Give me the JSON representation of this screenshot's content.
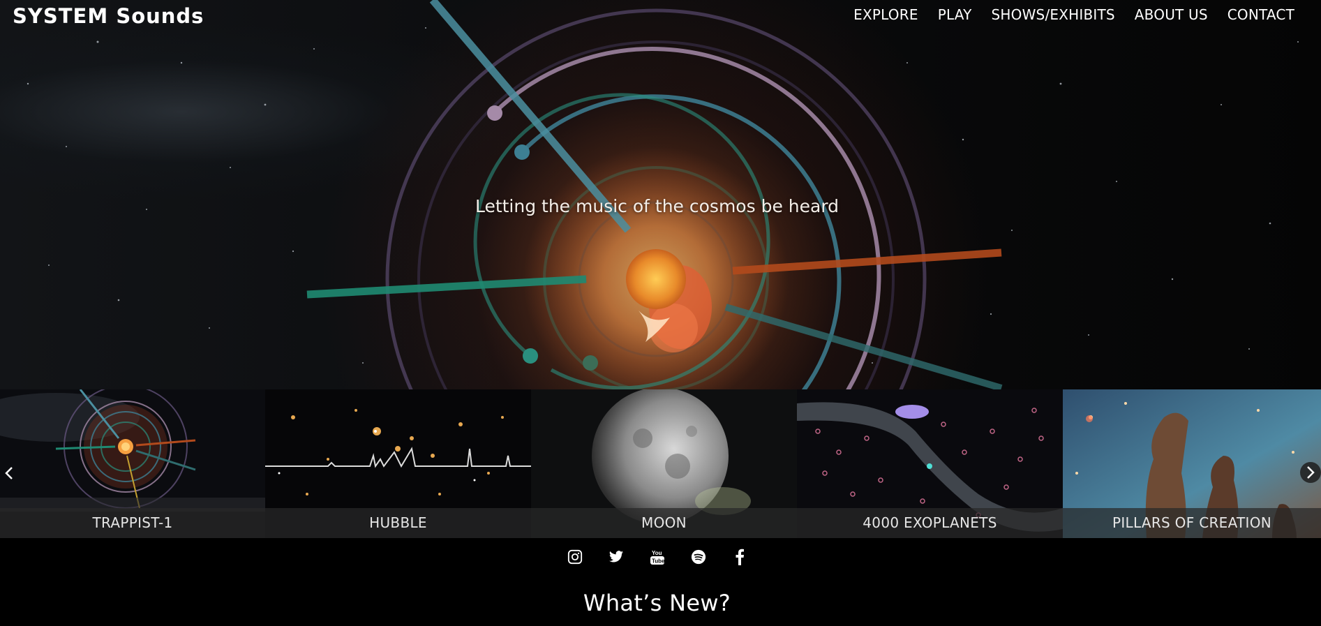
{
  "brand": "SYSTEM Sounds",
  "nav": {
    "explore": "EXPLORE",
    "play": "PLAY",
    "shows": "SHOWS/EXHIBITS",
    "about": "ABOUT US",
    "contact": "CONTACT"
  },
  "hero": {
    "tagline": "Letting the music of the cosmos be heard"
  },
  "carousel": {
    "items": [
      {
        "label": "TRAPPIST-1"
      },
      {
        "label": "HUBBLE"
      },
      {
        "label": "MOON"
      },
      {
        "label": "4000 EXOPLANETS"
      },
      {
        "label": "PILLARS OF CREATION"
      }
    ],
    "prev_icon": "chevron-left-icon",
    "next_icon": "chevron-right-icon"
  },
  "social": {
    "icons": [
      "instagram-icon",
      "twitter-icon",
      "youtube-icon",
      "spotify-icon",
      "facebook-icon"
    ]
  },
  "section": {
    "whats_new": "What’s New?"
  },
  "colors": {
    "background": "#000000",
    "teal": "#2a8f7e",
    "orange": "#c2511f",
    "lavender": "#a58aa8"
  }
}
